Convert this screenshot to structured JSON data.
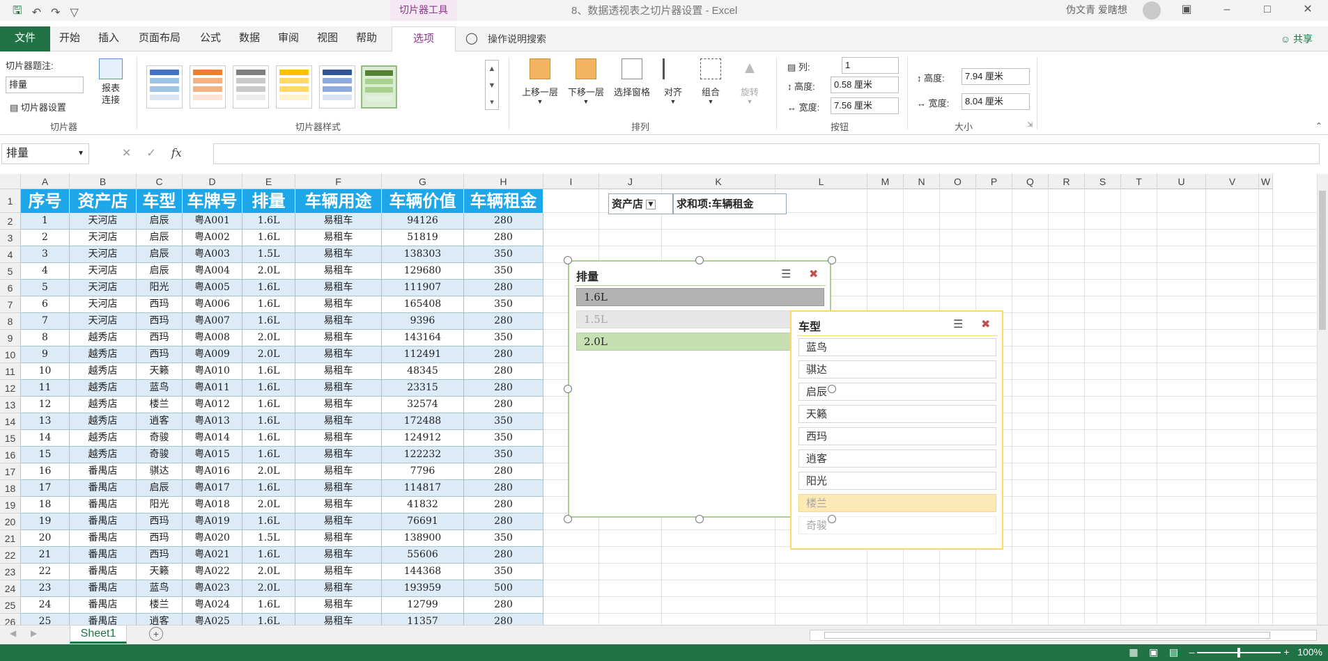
{
  "app": {
    "doc_title": "8、数据透视表之切片器设置 - Excel",
    "context_tab": "切片器工具",
    "user": "伪文青 爱瞎想",
    "qat_icons": [
      "save-icon",
      "undo-icon",
      "redo-icon",
      "customize-icon"
    ]
  },
  "tabs": [
    "文件",
    "开始",
    "插入",
    "页面布局",
    "公式",
    "数据",
    "审阅",
    "视图",
    "帮助",
    "选项"
  ],
  "tell_me": "操作说明搜索",
  "share": "共享",
  "ribbon": {
    "slicer_group": {
      "caption_label": "切片器题注:",
      "caption_value": "排量",
      "settings_label": "切片器设置",
      "report_conn_label": "报表连接",
      "group_label": "切片器"
    },
    "styles_group": {
      "group_label": "切片器样式"
    },
    "arrange_group": {
      "bring_forward": "上移一层",
      "send_backward": "下移一层",
      "selection_pane": "选择窗格",
      "align": "对齐",
      "group": "组合",
      "rotate": "旋转",
      "group_label": "排列"
    },
    "buttons_group": {
      "cols_label": "列:",
      "cols_value": "1",
      "height_label": "高度:",
      "height_value": "0.58 厘米",
      "width_label": "宽度:",
      "width_value": "7.56 厘米",
      "group_label": "按钮"
    },
    "size_group": {
      "height_label": "高度:",
      "height_value": "7.94 厘米",
      "width_label": "宽度:",
      "width_value": "8.04 厘米",
      "group_label": "大小"
    }
  },
  "formula_bar": {
    "name_box": "排量",
    "fx": "fx",
    "value": ""
  },
  "columns": [
    "A",
    "B",
    "C",
    "D",
    "E",
    "F",
    "G",
    "H",
    "I",
    "J",
    "K",
    "L",
    "M",
    "N",
    "O",
    "P",
    "Q",
    "R",
    "S",
    "T",
    "U",
    "V",
    "W"
  ],
  "row_numbers": [
    "1",
    "2",
    "3",
    "4",
    "5",
    "6",
    "7",
    "8",
    "9",
    "10",
    "11",
    "12",
    "13",
    "14",
    "15",
    "16",
    "17",
    "18",
    "19",
    "20",
    "21",
    "22",
    "23",
    "24",
    "25",
    "26"
  ],
  "table": {
    "headers": [
      "序号",
      "资产店",
      "车型",
      "车牌号",
      "排量",
      "车辆用途",
      "车辆价值",
      "车辆租金"
    ],
    "rows": [
      [
        "1",
        "天河店",
        "启辰",
        "粤A001",
        "1.6L",
        "易租车",
        "94126",
        "280"
      ],
      [
        "2",
        "天河店",
        "启辰",
        "粤A002",
        "1.6L",
        "易租车",
        "51819",
        "280"
      ],
      [
        "3",
        "天河店",
        "启辰",
        "粤A003",
        "1.5L",
        "易租车",
        "138303",
        "350"
      ],
      [
        "4",
        "天河店",
        "启辰",
        "粤A004",
        "2.0L",
        "易租车",
        "129680",
        "350"
      ],
      [
        "5",
        "天河店",
        "阳光",
        "粤A005",
        "1.6L",
        "易租车",
        "111907",
        "280"
      ],
      [
        "6",
        "天河店",
        "西玛",
        "粤A006",
        "1.6L",
        "易租车",
        "165408",
        "350"
      ],
      [
        "7",
        "天河店",
        "西玛",
        "粤A007",
        "1.6L",
        "易租车",
        "9396",
        "280"
      ],
      [
        "8",
        "越秀店",
        "西玛",
        "粤A008",
        "2.0L",
        "易租车",
        "143164",
        "350"
      ],
      [
        "9",
        "越秀店",
        "西玛",
        "粤A009",
        "2.0L",
        "易租车",
        "112491",
        "280"
      ],
      [
        "10",
        "越秀店",
        "天籁",
        "粤A010",
        "1.6L",
        "易租车",
        "48345",
        "280"
      ],
      [
        "11",
        "越秀店",
        "蓝鸟",
        "粤A011",
        "1.6L",
        "易租车",
        "23315",
        "280"
      ],
      [
        "12",
        "越秀店",
        "楼兰",
        "粤A012",
        "1.6L",
        "易租车",
        "32574",
        "280"
      ],
      [
        "13",
        "越秀店",
        "逍客",
        "粤A013",
        "1.6L",
        "易租车",
        "172488",
        "350"
      ],
      [
        "14",
        "越秀店",
        "奇骏",
        "粤A014",
        "1.6L",
        "易租车",
        "124912",
        "350"
      ],
      [
        "15",
        "越秀店",
        "奇骏",
        "粤A015",
        "1.6L",
        "易租车",
        "122232",
        "350"
      ],
      [
        "16",
        "番禺店",
        "骐达",
        "粤A016",
        "2.0L",
        "易租车",
        "7796",
        "280"
      ],
      [
        "17",
        "番禺店",
        "启辰",
        "粤A017",
        "1.6L",
        "易租车",
        "114817",
        "280"
      ],
      [
        "18",
        "番禺店",
        "阳光",
        "粤A018",
        "2.0L",
        "易租车",
        "41832",
        "280"
      ],
      [
        "19",
        "番禺店",
        "西玛",
        "粤A019",
        "1.6L",
        "易租车",
        "76691",
        "280"
      ],
      [
        "20",
        "番禺店",
        "西玛",
        "粤A020",
        "1.5L",
        "易租车",
        "138900",
        "350"
      ],
      [
        "21",
        "番禺店",
        "西玛",
        "粤A021",
        "1.6L",
        "易租车",
        "55606",
        "280"
      ],
      [
        "22",
        "番禺店",
        "天籁",
        "粤A022",
        "2.0L",
        "易租车",
        "144368",
        "350"
      ],
      [
        "23",
        "番禺店",
        "蓝鸟",
        "粤A023",
        "2.0L",
        "易租车",
        "193959",
        "500"
      ],
      [
        "24",
        "番禺店",
        "楼兰",
        "粤A024",
        "1.6L",
        "易租车",
        "12799",
        "280"
      ],
      [
        "25",
        "番禺店",
        "逍客",
        "粤A025",
        "1.6L",
        "易租车",
        "11357",
        "280"
      ]
    ]
  },
  "pivot": {
    "row_label": "资产店",
    "value_label": "求和项:车辆租金"
  },
  "slicer_displacement": {
    "title": "排量",
    "items": [
      {
        "label": "1.6L",
        "state": "selected"
      },
      {
        "label": "1.5L",
        "state": "unavailable"
      },
      {
        "label": "2.0L",
        "state": "selected-green"
      }
    ]
  },
  "slicer_model": {
    "title": "车型",
    "items": [
      {
        "label": "蓝鸟",
        "state": "normal"
      },
      {
        "label": "骐达",
        "state": "normal"
      },
      {
        "label": "启辰",
        "state": "normal"
      },
      {
        "label": "天籁",
        "state": "normal"
      },
      {
        "label": "西玛",
        "state": "normal"
      },
      {
        "label": "逍客",
        "state": "normal"
      },
      {
        "label": "阳光",
        "state": "normal"
      },
      {
        "label": "楼兰",
        "state": "highlight"
      },
      {
        "label": "奇骏",
        "state": "unavailable"
      }
    ]
  },
  "sheet_tab": "Sheet1",
  "zoom": "100%",
  "colors": {
    "excel_green": "#217346",
    "header_blue": "#1ea7e8",
    "band_blue": "#ddebf7",
    "slicer_selected": "#b3b3b3",
    "slicer_green": "#c6e0b4",
    "slicer_yellow": "#fde9b6"
  }
}
